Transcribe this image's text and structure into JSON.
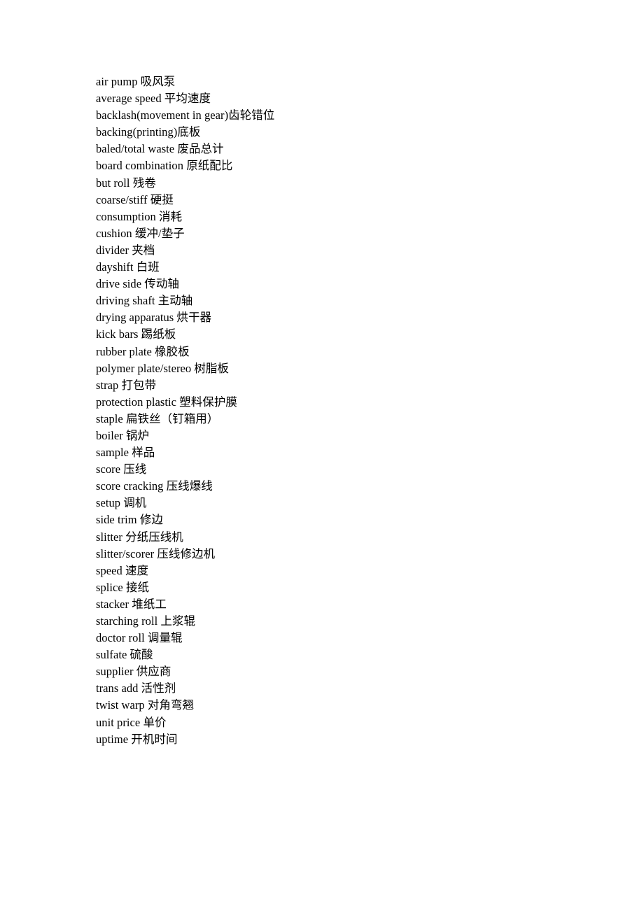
{
  "document": {
    "page_background": "#ffffff",
    "text_color": "#000000",
    "entries": [
      "air pump 吸风泵",
      "average speed 平均速度",
      "backlash(movement in gear)齿轮错位",
      "backing(printing)底板",
      "baled/total waste 废品总计",
      "board combination 原纸配比",
      "but roll 残卷",
      "coarse/stiff 硬挺",
      "consumption 消耗",
      "cushion 缓冲/垫子",
      "divider 夹档",
      "dayshift 白班",
      "drive side 传动轴",
      "driving shaft 主动轴",
      "drying apparatus 烘干器",
      "kick bars 踢纸板",
      "rubber plate 橡胶板",
      "polymer plate/stereo 树脂板",
      "strap 打包带",
      "protection plastic 塑料保护膜",
      "staple 扁铁丝（钉箱用）",
      "boiler 锅炉",
      "sample 样品",
      "score 压线",
      "score cracking 压线爆线",
      "setup 调机",
      "side trim 修边",
      "slitter 分纸压线机",
      "slitter/scorer 压线修边机",
      "speed 速度",
      "splice 接纸",
      "stacker 堆纸工",
      "starching roll 上浆辊",
      "doctor roll 调量辊",
      "sulfate 硫酸",
      "supplier 供应商",
      "trans add 活性剂",
      "twist warp 对角弯翘",
      "unit price 单价",
      "uptime 开机时间"
    ]
  }
}
